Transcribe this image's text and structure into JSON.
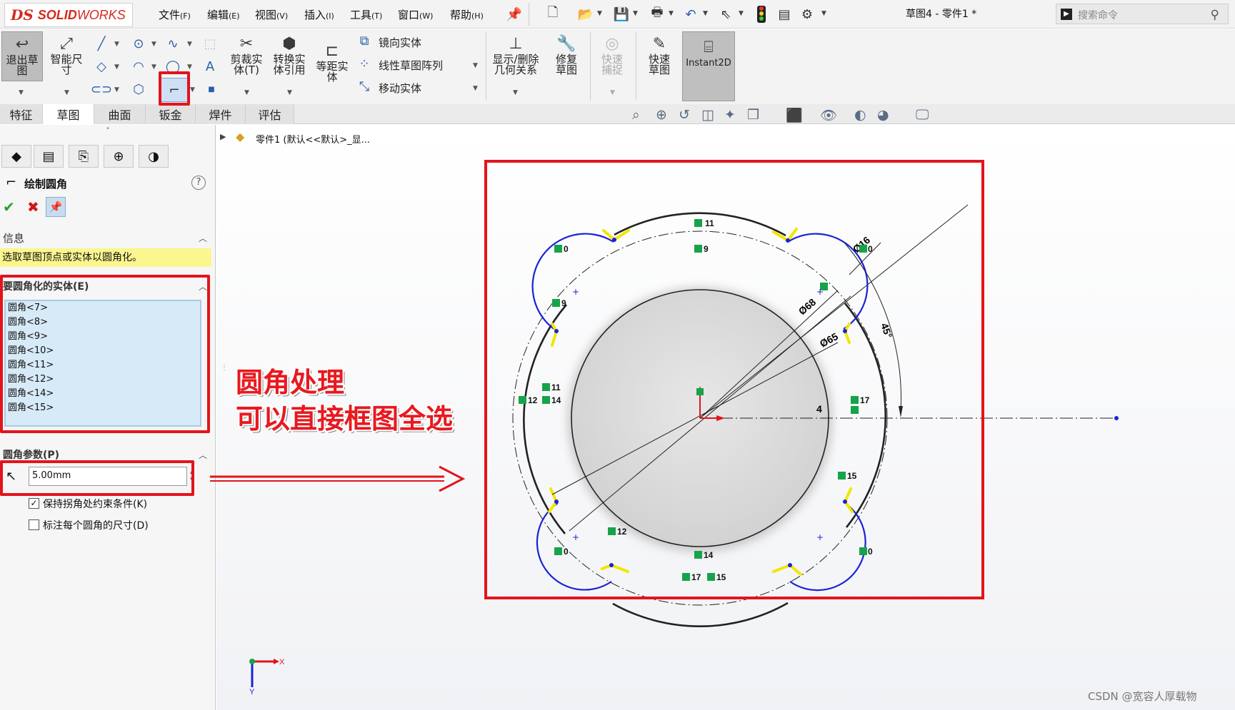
{
  "app": {
    "logo_ds": "DS",
    "logo_solid": "SOLID",
    "logo_works": "WORKS",
    "doc_title": "草图4 - 零件1 *"
  },
  "menu": [
    {
      "label": "文件",
      "key": "(F)"
    },
    {
      "label": "编辑",
      "key": "(E)"
    },
    {
      "label": "视图",
      "key": "(V)"
    },
    {
      "label": "插入",
      "key": "(I)"
    },
    {
      "label": "工具",
      "key": "(T)"
    },
    {
      "label": "窗口",
      "key": "(W)"
    },
    {
      "label": "帮助",
      "key": "(H)"
    }
  ],
  "search": {
    "placeholder": "搜索命令"
  },
  "ribbon": {
    "exit_sketch": "退出草图",
    "smart_dim": "智能尺寸",
    "trim": "剪裁实体(T)",
    "convert": "转换实体引用",
    "offset": "等距实体",
    "mirror": "镜向实体",
    "linear_pattern": "线性草图阵列",
    "move": "移动实体",
    "show_delete": "显示/删除几何关系",
    "repair": "修复草图",
    "quick_snap": "快速捕捉",
    "rapid_sketch": "快速草图",
    "instant2d": "Instant2D"
  },
  "tabs": [
    "特征",
    "草图",
    "曲面",
    "钣金",
    "焊件",
    "评估"
  ],
  "tree": {
    "node": "零件1 (默认<<默认>_显..."
  },
  "panel": {
    "title": "绘制圆角",
    "info_header": "信息",
    "info_text": "选取草图顶点或实体以圆角化。",
    "entities_header": "要圆角化的实体(E)",
    "entities": [
      "圆角<7>",
      "圆角<8>",
      "圆角<9>",
      "圆角<10>",
      "圆角<11>",
      "圆角<12>",
      "圆角<14>",
      "圆角<15>"
    ],
    "params_header": "圆角参数(P)",
    "radius": "5.00mm",
    "keep_constraints": "保持拐角处约束条件(K)",
    "dimension_each": "标注每个圆角的尺寸(D)"
  },
  "annotation": {
    "line1": "圆角处理",
    "line2": "可以直接框图全选"
  },
  "drawing": {
    "dims": {
      "d16": "Ø16",
      "d68": "Ø68",
      "d65": "Ø65",
      "angle": "45°",
      "four": "4"
    },
    "markers": [
      "11",
      "9",
      "0",
      "0",
      "9",
      "11",
      "12",
      "14",
      "17",
      "15",
      "12",
      "0",
      "14",
      "0",
      "17",
      "15"
    ]
  },
  "triad": {
    "x": "X",
    "y": "Y"
  },
  "watermark": "CSDN @宽容人厚载物",
  "colors": {
    "red": "#e3141b",
    "blue": "#1a22d6",
    "yellow": "#f2e600",
    "green": "#16a34a"
  }
}
